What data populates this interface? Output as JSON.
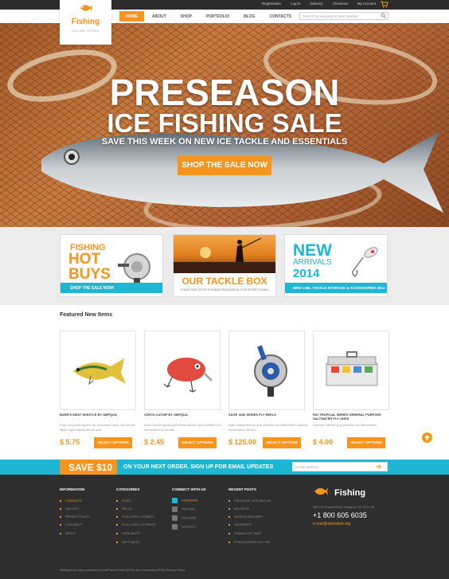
{
  "colors": {
    "accent": "#f7941d",
    "secondary": "#1eb6d2",
    "footer": "#2e2e2e"
  },
  "topbar": {
    "links": [
      "Registration",
      "Log In",
      "Delivery",
      "Checkout",
      "My Account"
    ],
    "cart_icon": "cart-icon"
  },
  "logo": {
    "name": "Fishing",
    "tagline": "ONLINE STORE"
  },
  "nav": {
    "items": [
      "HOME",
      "ABOUT",
      "SHOP",
      "PORTFOLIO",
      "BLOG",
      "CONTACTS"
    ],
    "active": "HOME"
  },
  "search": {
    "placeholder": "Search by keyword or item number"
  },
  "hero": {
    "line1": "PRESEASON",
    "line2": "ICE FISHING SALE",
    "line3": "SAVE THIS WEEK ON NEW ICE TACKLE AND ESSENTIALS",
    "button": "SHOP THE SALE NOW"
  },
  "promos": {
    "p1": {
      "line1": "FISHING",
      "line2": "HOT",
      "line3": "BUYS",
      "bar": "SHOP THE SALE NOW!"
    },
    "p2": {
      "title": "OUR TACKLE BOX",
      "subtitle": "YOUR ONE STOP FISHING RESOURCE FOR EVERYTHING"
    },
    "p3": {
      "line1": "NEW",
      "line2": "ARRIVALS",
      "line3": "2014",
      "bar": "NEW LINE, TACKLE STORAGE & ACCESSORIES 2014"
    }
  },
  "featured": {
    "title": "Featured New Items",
    "button_label": "SELECT OPTIONS",
    "products": [
      {
        "name": "BARR'S MEAT WHISTLE BY UMPQUA",
        "desc": "Proin eu purus sapien, ey accumsan dolor orci iaculis ligula eget massa dictum quis",
        "price": "$ 5.75"
      },
      {
        "name": "CZECH CATNIP BY UMPQUA",
        "desc": "Nunc iaculis ligula eget massa dictum quis porttitor orci elementum in lobortis",
        "price": "$ 2.45"
      },
      {
        "name": "SAGE 4200 SERIES FLY REELS",
        "desc": "Eget massa dictum quis porttitor orci elementum lobortis consectetur elit sed",
        "price": "$ 125.00"
      },
      {
        "name": "RIO TROPICAL SERIES GENERAL PURPOSE SALTWATER FLY LINES",
        "desc": "Vivamus dictum quis porttitor orci elementum",
        "price": "$ 4.00"
      }
    ]
  },
  "newsletter": {
    "save": "SAVE $10",
    "text": "ON YOUR NEXT ORDER. SIGN UP FOR EMAIL UPDATES",
    "placeholder": "e-mail address"
  },
  "footer": {
    "information": {
      "title": "INFORMATION",
      "items": [
        "CONTACTS",
        "GALLERY",
        "PRIVACY POLICY",
        "CHECKOUT",
        "ABOUT"
      ]
    },
    "categories": {
      "title": "CATEGORIES",
      "items": [
        "RODS",
        "REELS",
        "ROD & REEL COMBOS",
        "ROD & REEL STORAGE",
        "HARD BAITS",
        "SOFT BAITS"
      ]
    },
    "connect": {
      "title": "CONNECT WITH US",
      "items": [
        "FACEBOOK",
        "TWITTER",
        "YOUTUBE",
        "GOOGLE+"
      ]
    },
    "recent": {
      "title": "RECENT POSTS",
      "items": [
        "FREQUENT VESTIBULUM",
        "MOLESTIE",
        "AENEAN NONUMMY",
        "HENDRERIT",
        "VIVAMUS SIT AMET",
        "ETIAM CURSUS LEO VEL"
      ]
    },
    "brand": "Fishing",
    "address": "9870 St Vincent Place, Glasgow, DC 45 Fr 45",
    "phone": "+1 800 605 6035",
    "email": "e-mail@demolink.org",
    "copyright": "Fishing is proudly powered by WordPress Entries (RSS) and Comments (RSS) Privacy Policy"
  }
}
